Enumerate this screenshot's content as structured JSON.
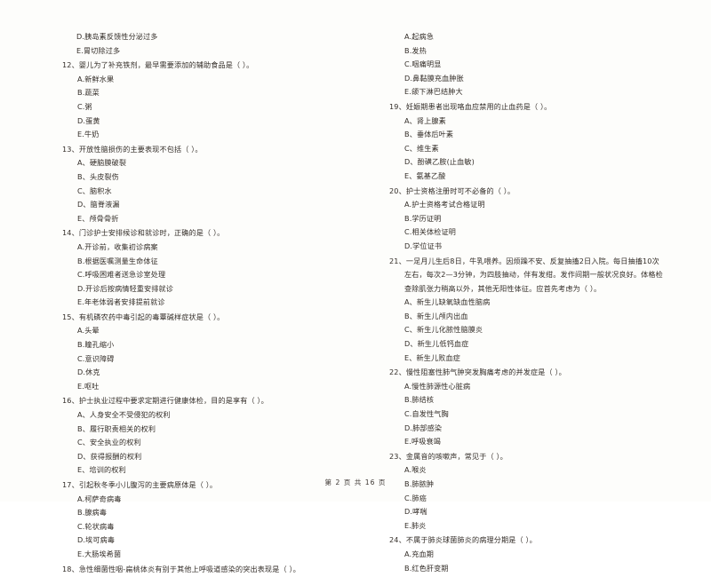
{
  "document": {
    "type": "scanned-exam-paper",
    "footer": "第 2 页 共 16 页"
  },
  "left_column": {
    "orphan_options": [
      "D.胰岛素反馈性分泌过多",
      "E.胃切除过多"
    ],
    "questions": [
      {
        "stem": "12、婴儿为了补充铁剂，最早需要添加的辅助食品是（      ）。",
        "options": [
          "A.新鲜水果",
          "B.蔬菜",
          "C.粥",
          "D.蛋黄",
          "E.牛奶"
        ]
      },
      {
        "stem": "13、开放性脑损伤的主要表现不包括（      ）。",
        "options": [
          "A、硬脑膜破裂",
          "B、头皮裂伤",
          "C、脑积水",
          "D、脑脊液漏",
          "E、颅骨骨折"
        ]
      },
      {
        "stem": "14、门诊护士安排候诊和就诊时，正确的是（      ）。",
        "options": [
          "A.开诊前，收集初诊病案",
          "B.根据医嘱测量生命体征",
          "C.呼吸困难者送急诊室处理",
          "D.开诊后按病情轻重安排就诊",
          "E.年老体弱者安排提前就诊"
        ]
      },
      {
        "stem": "15、有机磷农药中毒引起的毒蕈碱样症状是（      ）。",
        "options": [
          "A.头晕",
          "B.瞳孔缩小",
          "C.意识障碍",
          "D.休克",
          "E.呕吐"
        ]
      },
      {
        "stem": "16、护士执业过程中要求定期进行健康体检，目的是享有（      ）。",
        "options": [
          "A、人身安全不受侵犯的权利",
          "B、履行职责相关的权利",
          "C、安全执业的权利",
          "D、获得报酬的权利",
          "E、培训的权利"
        ]
      },
      {
        "stem": "17、引起秋冬季小儿腹泻的主要病原体是（      ）。",
        "options": [
          "A.柯萨奇病毒",
          "B.腺病毒",
          "C.轮状病毒",
          "D.埃可病毒",
          "E.大肠埃希菌"
        ]
      },
      {
        "stem": "18、急性细菌性咽-扁桃体炎有别于其他上呼吸道感染的突出表现是（      ）。",
        "options": []
      }
    ]
  },
  "right_column": {
    "orphan_options": [
      "A.起病急",
      "B.发热",
      "C.咽痛明显",
      "D.鼻黏膜充血肿胀",
      "E.颌下淋巴结肿大"
    ],
    "questions": [
      {
        "stem": "19、妊娠期患者出现咯血应禁用的止血药是（      ）。",
        "options": [
          "A、肾上腺素",
          "B、垂体后叶素",
          "C、维生素",
          "D、酚磺乙胺(止血敏)",
          "E、氨基乙酸"
        ]
      },
      {
        "stem": "20、护士资格注册时可不必备的（      ）。",
        "options": [
          "A.护士资格考试合格证明",
          "B.学历证明",
          "C.相关体检证明",
          "D.学位证书"
        ]
      },
      {
        "stem": "21、一足月儿生后8日，牛乳喂养。因烦躁不安、反复抽搐2日入院。每日抽搐10次左右，每次2—3分钟，为四肢抽动，伴有发绀。发作间期一般状况良好。体格检查除肌张力稍高以外，其他无阳性体征。应首先考虑为（      ）。",
        "options": [
          "A、新生儿缺氧缺血性脑病",
          "B、新生儿颅内出血",
          "C、新生儿化脓性脑膜炎",
          "D、新生儿低钙血症",
          "E、新生儿败血症"
        ]
      },
      {
        "stem": "22、慢性阻塞性肺气肿突发胸痛考虑的并发症是（      ）。",
        "options": [
          "A.慢性肺源性心脏病",
          "B.肺结核",
          "C.自发性气胸",
          "D.肺部感染",
          "E.呼吸衰竭"
        ]
      },
      {
        "stem": "23、金属音的咳嗽声，常见于（      ）。",
        "options": [
          "A.喉炎",
          "B.肺脓肿",
          "C.肺癌",
          "D.哮喘",
          "E.肺炎"
        ]
      },
      {
        "stem": "24、不属于肺炎球菌肺炎的病理分期是（      ）。",
        "options": [
          "A.充血期",
          "B.红色肝变期"
        ]
      }
    ]
  }
}
